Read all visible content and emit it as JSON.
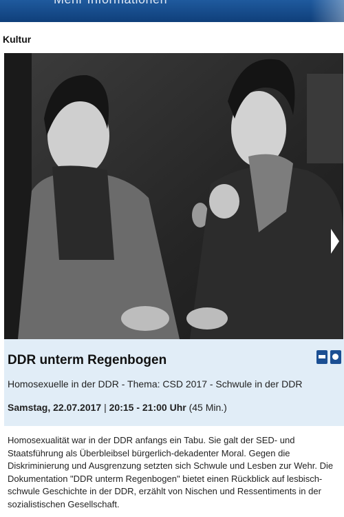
{
  "header": {
    "brand": "Mehr Informationen",
    "color": "#1a4f8f"
  },
  "section": {
    "label": "Kultur"
  },
  "media": {
    "image_alt": "Zwei lachende Frauen, Schwarzweißfoto",
    "next_icon": "chevron-right-icon"
  },
  "program": {
    "title": "DDR unterm Regenbogen",
    "subtitle": "Homosexuelle in der DDR - Thema: CSD 2017 - Schwule in der DDR",
    "date": "Samstag, 22.07.2017",
    "separator": " | ",
    "time": "20:15 - 21:00 Uhr",
    "duration": " (45 Min.)",
    "icons": [
      "subtitle-icon",
      "audio-description-icon"
    ],
    "description": "Homosexualität war in der DDR anfangs ein Tabu. Sie galt der SED- und Staatsführung als Überbleibsel bürgerlich-dekadenter Moral. Gegen die Diskriminierung und Ausgrenzung setzten sich Schwule und Lesben zur Wehr. Die Dokumentation \"DDR unterm Regenbogen\" bietet einen Rückblick auf lesbisch-schwule Geschichte in der DDR, erzählt von Nischen und Ressentiments in der sozialistischen Gesellschaft."
  }
}
